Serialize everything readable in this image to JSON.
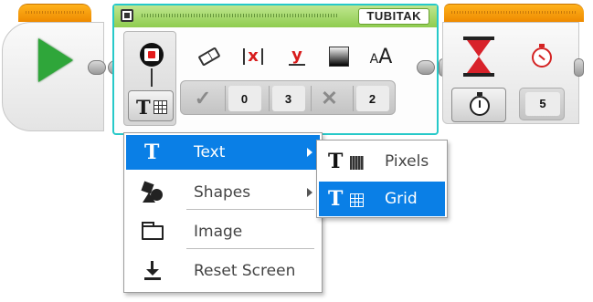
{
  "display_block": {
    "file_name": "TUBITAK",
    "params": {
      "clear_screen": "✓",
      "x": "0",
      "y": "3",
      "color": "✕",
      "font": "2"
    }
  },
  "wait_block": {
    "seconds": "5"
  },
  "mode_menu": {
    "items": [
      {
        "label": "Text",
        "icon": "text-t-icon",
        "has_submenu": true,
        "selected": true
      },
      {
        "label": "Shapes",
        "icon": "shapes-icon",
        "has_submenu": true,
        "selected": false
      },
      {
        "label": "Image",
        "icon": "folder-icon",
        "has_submenu": false,
        "selected": false
      },
      {
        "label": "Reset Screen",
        "icon": "download-icon",
        "has_submenu": false,
        "selected": false
      }
    ]
  },
  "text_submenu": {
    "items": [
      {
        "label": "Pixels",
        "icon": "text-pixels-icon",
        "selected": false
      },
      {
        "label": "Grid",
        "icon": "text-grid-icon",
        "selected": true
      }
    ]
  },
  "colors": {
    "accent_selected": "#0a7fe6",
    "block_selected_border": "#26c9c9",
    "action_block_header": "#8fcc4f",
    "flow_block_header": "#ee8a00",
    "play": "#2fa63a"
  }
}
